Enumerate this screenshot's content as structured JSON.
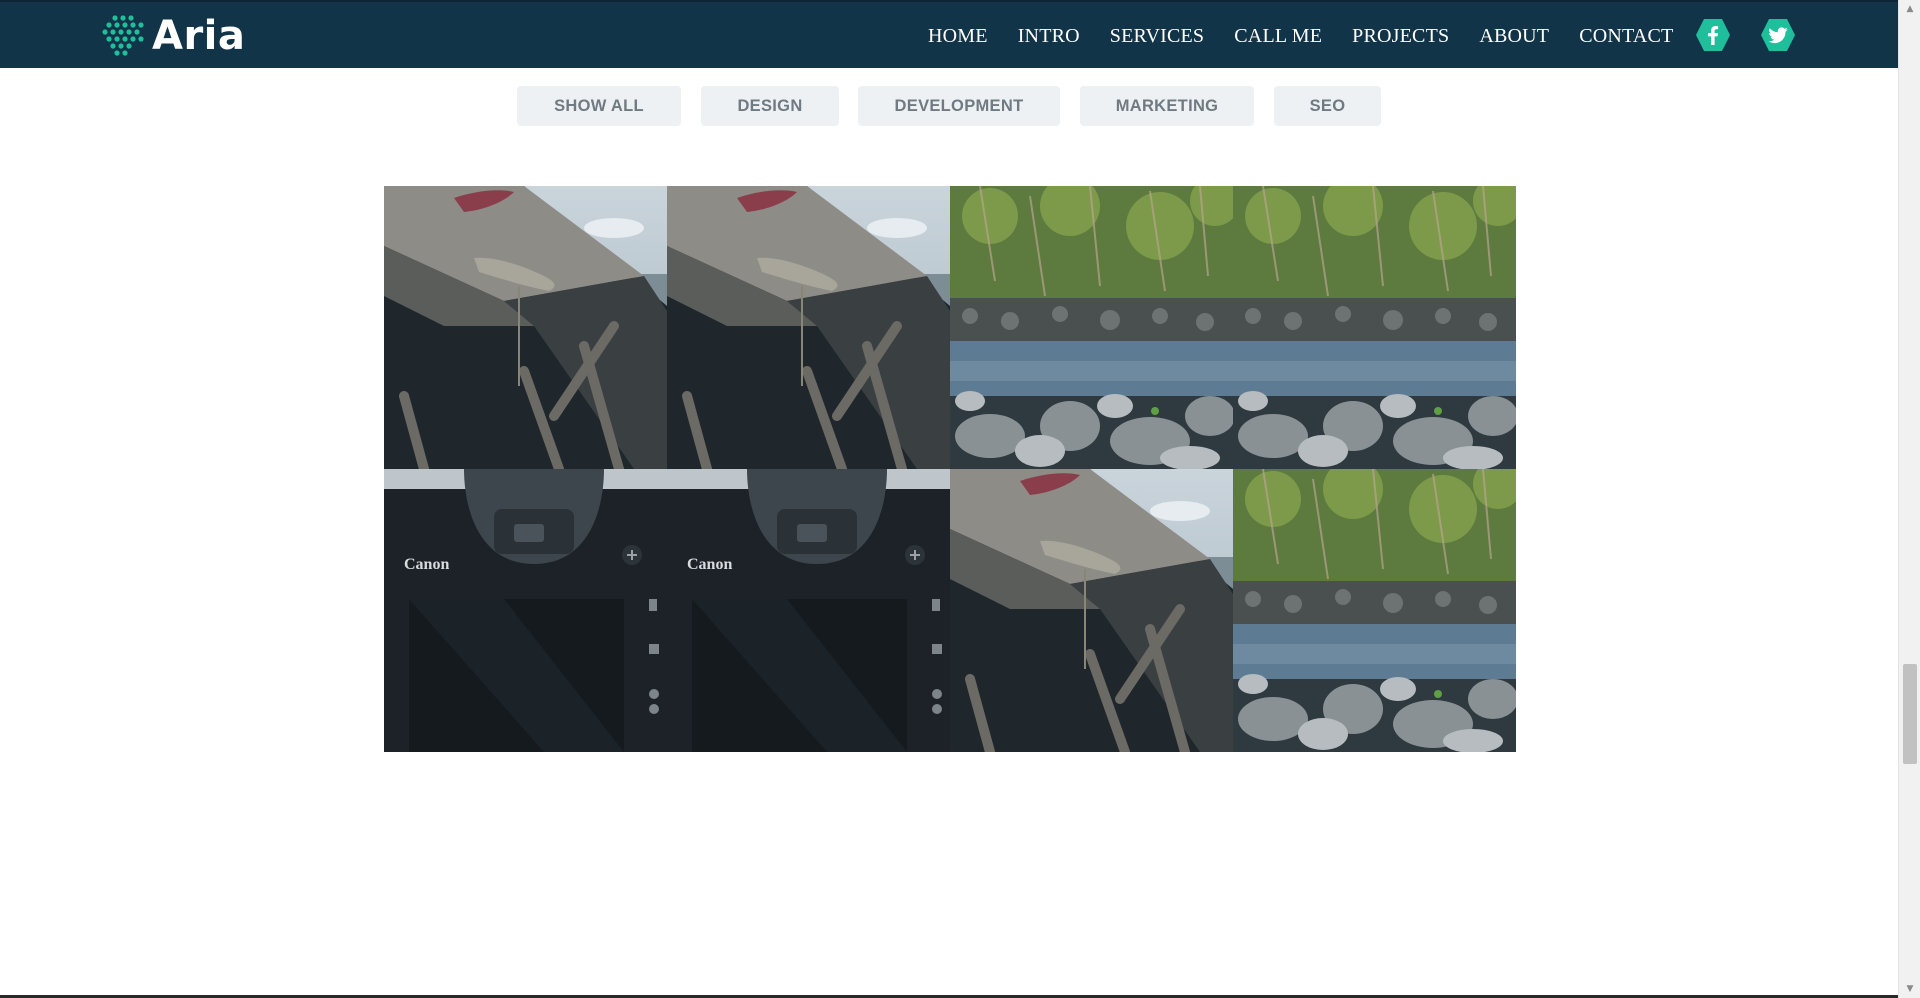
{
  "brand": {
    "name": "Aria",
    "accent_color": "#1fbf9b",
    "nav_bg": "#113448"
  },
  "nav": {
    "items": [
      {
        "label": "HOME"
      },
      {
        "label": "INTRO"
      },
      {
        "label": "SERVICES"
      },
      {
        "label": "CALL ME"
      },
      {
        "label": "PROJECTS"
      },
      {
        "label": "ABOUT"
      },
      {
        "label": "CONTACT"
      }
    ],
    "social": [
      {
        "icon": "facebook-icon"
      },
      {
        "icon": "twitter-icon"
      }
    ]
  },
  "filters": [
    {
      "label": "SHOW ALL"
    },
    {
      "label": "DESIGN"
    },
    {
      "label": "DEVELOPMENT"
    },
    {
      "label": "MARKETING"
    },
    {
      "label": "SEO"
    }
  ],
  "gallery": {
    "items": [
      {
        "image": "boat"
      },
      {
        "image": "boat"
      },
      {
        "image": "rocky-shore"
      },
      {
        "image": "rocky-shore"
      },
      {
        "image": "camera"
      },
      {
        "image": "camera"
      },
      {
        "image": "boat"
      },
      {
        "image": "rocky-shore"
      }
    ],
    "camera_brand_text": "Canon"
  }
}
